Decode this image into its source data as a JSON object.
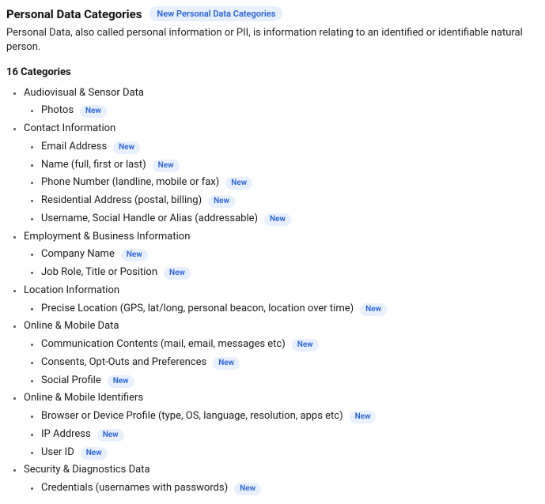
{
  "header": {
    "title": "Personal Data Categories",
    "action_label": "New Personal Data Categories"
  },
  "description": "Personal Data, also called personal information or PII, is information relating to an identified or identifiable natural person.",
  "count_heading": "16 Categories",
  "badge_new": "New",
  "categories": [
    {
      "label": "Audiovisual & Sensor Data",
      "new": false,
      "children": [
        {
          "label": "Photos",
          "new": true
        }
      ]
    },
    {
      "label": "Contact Information",
      "new": false,
      "children": [
        {
          "label": "Email Address",
          "new": true
        },
        {
          "label": "Name (full, first or last)",
          "new": true
        },
        {
          "label": "Phone Number (landline, mobile or fax)",
          "new": true
        },
        {
          "label": "Residential Address (postal, billing)",
          "new": true
        },
        {
          "label": "Username, Social Handle or Alias (addressable)",
          "new": true
        }
      ]
    },
    {
      "label": "Employment & Business Information",
      "new": false,
      "children": [
        {
          "label": "Company Name",
          "new": true
        },
        {
          "label": "Job Role, Title or Position",
          "new": true
        }
      ]
    },
    {
      "label": "Location Information",
      "new": false,
      "children": [
        {
          "label": "Precise Location (GPS, lat/long, personal beacon, location over time)",
          "new": true
        }
      ]
    },
    {
      "label": "Online & Mobile Data",
      "new": false,
      "children": [
        {
          "label": "Communication Contents (mail, email, messages etc)",
          "new": true
        },
        {
          "label": "Consents, Opt-Outs and Preferences",
          "new": true
        },
        {
          "label": "Social Profile",
          "new": true
        }
      ]
    },
    {
      "label": "Online & Mobile Identifiers",
      "new": false,
      "children": [
        {
          "label": "Browser or Device Profile (type, OS, language, resolution, apps etc)",
          "new": true
        },
        {
          "label": "IP Address",
          "new": true
        },
        {
          "label": "User ID",
          "new": true
        }
      ]
    },
    {
      "label": "Security & Diagnostics Data",
      "new": false,
      "children": [
        {
          "label": "Credentials (usernames with passwords)",
          "new": true
        }
      ]
    }
  ]
}
